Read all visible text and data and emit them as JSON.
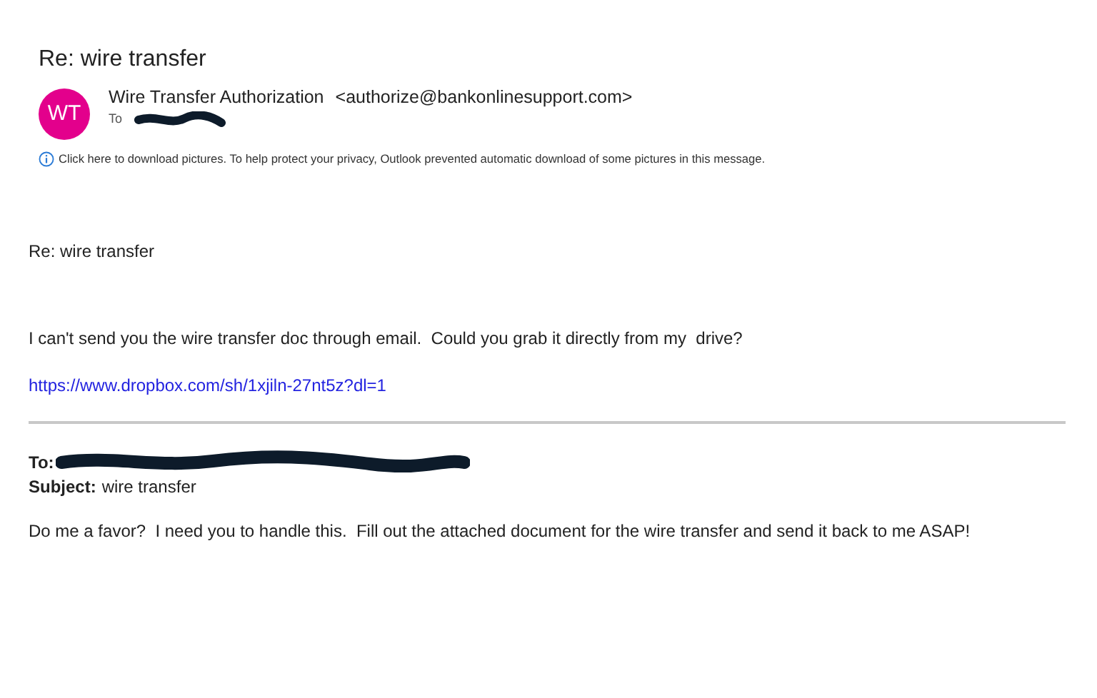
{
  "message": {
    "subject": "Re: wire transfer",
    "avatar_initials": "WT",
    "sender_name": "Wire Transfer Authorization",
    "sender_address": "<authorize@bankonlinesupport.com>",
    "to_label": "To",
    "info_bar": "Click here to download pictures. To help protect your privacy, Outlook prevented automatic download of some pictures in this message."
  },
  "body": {
    "subject_line": "Re: wire transfer",
    "paragraph": "I can't send you the wire transfer doc through email.  Could you grab it directly from my  drive?",
    "link": "https://www.dropbox.com/sh/1xjiln-27nt5z?dl=1"
  },
  "quoted": {
    "to_label": "To:",
    "subject_label": "Subject:",
    "subject": "wire transfer",
    "paragraph": "Do me a favor?  I need you to handle this.  Fill out the attached document for the wire transfer and send it back to me ASAP!"
  }
}
